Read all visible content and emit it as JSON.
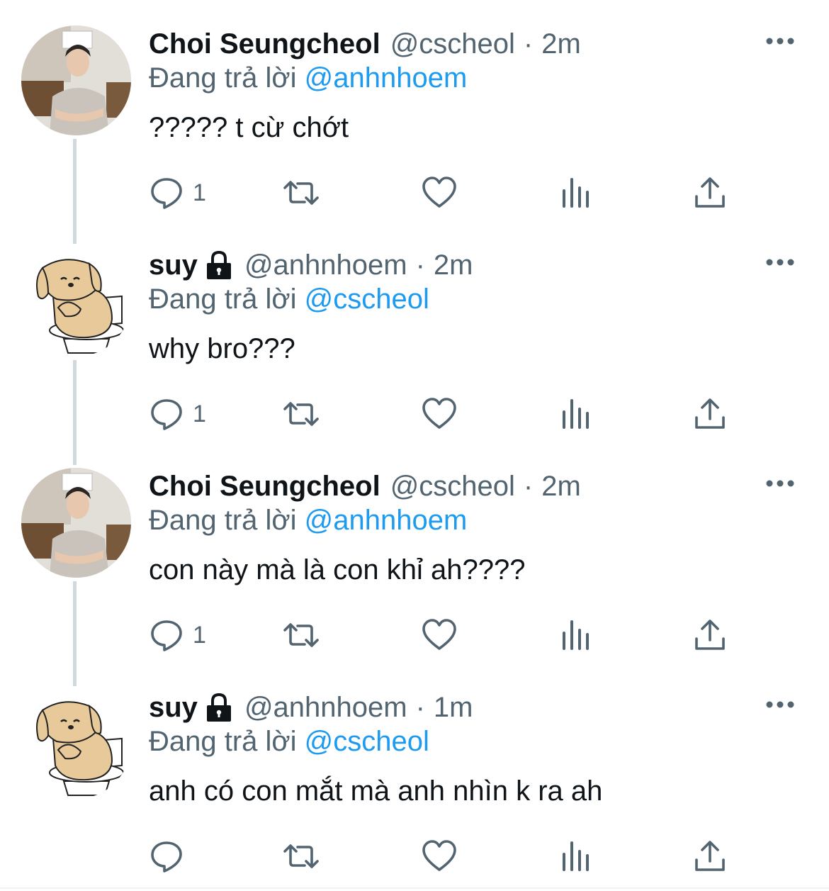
{
  "tweets": [
    {
      "name": "Choi Seungcheol",
      "locked": false,
      "handle": "@cscheol",
      "separator": "·",
      "time": "2m",
      "reply_prefix": "Đang trả lời",
      "reply_to": "@anhnhoem",
      "text": "????? t cừ chớt",
      "reply_count": "1",
      "avatar": "photo"
    },
    {
      "name": "suy",
      "locked": true,
      "handle": "@anhnhoem",
      "separator": "·",
      "time": "2m",
      "reply_prefix": "Đang trả lời",
      "reply_to": "@cscheol",
      "text": "why bro???",
      "reply_count": "1",
      "avatar": "cartoon"
    },
    {
      "name": "Choi Seungcheol",
      "locked": false,
      "handle": "@cscheol",
      "separator": "·",
      "time": "2m",
      "reply_prefix": "Đang trả lời",
      "reply_to": "@anhnhoem",
      "text": "con này mà là con khỉ ah????",
      "reply_count": "1",
      "avatar": "photo"
    },
    {
      "name": "suy",
      "locked": true,
      "handle": "@anhnhoem",
      "separator": "·",
      "time": "1m",
      "reply_prefix": "Đang trả lời",
      "reply_to": "@cscheol",
      "text": "anh có con mắt mà anh nhìn k ra ah",
      "reply_count": "",
      "avatar": "cartoon"
    }
  ],
  "icons": {
    "more": "more-dots-icon",
    "reply": "reply-bubble-icon",
    "retweet": "retweet-icon",
    "like": "heart-icon",
    "analytics": "analytics-bars-icon",
    "share": "share-upload-icon",
    "lock": "lock-icon"
  },
  "colors": {
    "text": "#0f1419",
    "secondary": "#536471",
    "mention": "#1d9bf0",
    "thread_line": "#cfd9de"
  }
}
